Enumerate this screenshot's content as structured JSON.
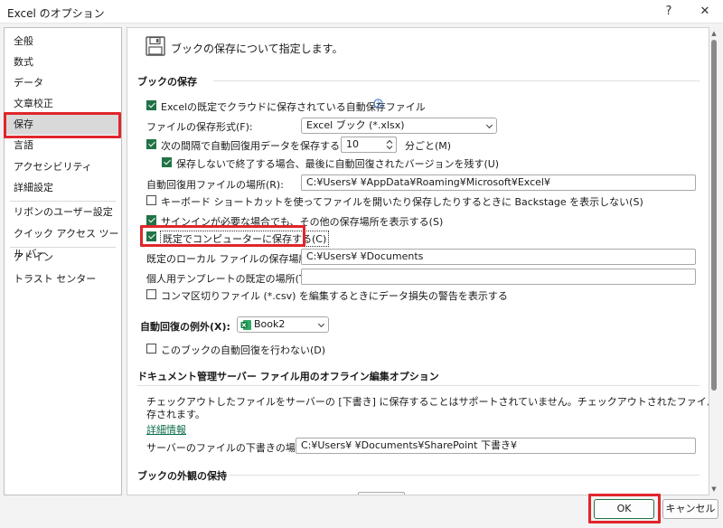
{
  "window": {
    "title": "Excel のオプション",
    "help_label": "?",
    "close_label": "✕"
  },
  "sidebar": {
    "items": [
      {
        "label": "全般"
      },
      {
        "label": "数式"
      },
      {
        "label": "データ"
      },
      {
        "label": "文章校正"
      },
      {
        "label": "保存"
      },
      {
        "label": "言語"
      },
      {
        "label": "アクセシビリティ"
      },
      {
        "label": "詳細設定"
      },
      {
        "label": "リボンのユーザー設定"
      },
      {
        "label": "クイック アクセス ツール バー"
      },
      {
        "label": "アドイン"
      },
      {
        "label": "トラスト センター"
      }
    ],
    "selected": "保存"
  },
  "main": {
    "header": "ブックの保存について指定します。",
    "save_section": {
      "title": "ブックの保存",
      "autosave_cloud_label": "Excelの既定でクラウドに保存されている自動保存ファイル",
      "autosave_cloud_checked": true,
      "format_label": "ファイルの保存形式(F):",
      "format_value": "Excel ブック (*.xlsx)",
      "autorecover_interval_label": "次の間隔で自動回復用データを保存する(A):",
      "autorecover_interval_checked": true,
      "autorecover_interval_value": "10",
      "autorecover_interval_unit": "分ごと(M)",
      "keep_last_label": "保存しないで終了する場合、最後に自動回復されたバージョンを残す(U)",
      "keep_last_checked": true,
      "autorecover_location_label": "自動回復用ファイルの場所(R):",
      "autorecover_location_value": "C:¥Users¥        ¥AppData¥Roaming¥Microsoft¥Excel¥",
      "no_backstage_label": "キーボード ショートカットを使ってファイルを開いたり保存したりするときに Backstage を表示しない(S)",
      "no_backstage_checked": false,
      "show_signin_label": "サインインが必要な場合でも、その他の保存場所を表示する(S)",
      "show_signin_checked": true,
      "save_to_computer_label": "既定でコンピューターに保存する(C)",
      "save_to_computer_checked": true,
      "local_location_label": "既定のローカル ファイルの保存場所(I):",
      "local_location_value": "C:¥Users¥        ¥Documents",
      "template_location_label": "個人用テンプレートの既定の場所(T):",
      "template_location_value": "",
      "csv_warning_label": "コンマ区切りファイル (*.csv) を編集するときにデータ損失の警告を表示する",
      "csv_warning_checked": false
    },
    "exceptions_section": {
      "title": "自動回復の例外(X):",
      "workbook_value": "Book2",
      "disable_autorecover_label": "このブックの自動回復を行わない(D)",
      "disable_autorecover_checked": false
    },
    "offline_section": {
      "title": "ドキュメント管理サーバー ファイル用のオフライン編集オプション",
      "description_line1": "チェックアウトしたファイルをサーバーの [下書き] に保存することはサポートされていません。チェックアウトされたファイルは Office ドキュメント キャッシュに保",
      "description_line2": "存されます。",
      "more_info_label": "詳細情報",
      "drafts_location_label": "サーバーのファイルの下書きの場所(V):",
      "drafts_location_value": "C:¥Users¥        ¥Documents¥SharePoint 下書き¥"
    },
    "appearance_section": {
      "title": "ブックの外観の保持"
    }
  },
  "footer": {
    "ok_label": "OK",
    "cancel_label": "キャンセル"
  },
  "colors": {
    "accent": "#217346",
    "highlight": "#e0262b"
  }
}
